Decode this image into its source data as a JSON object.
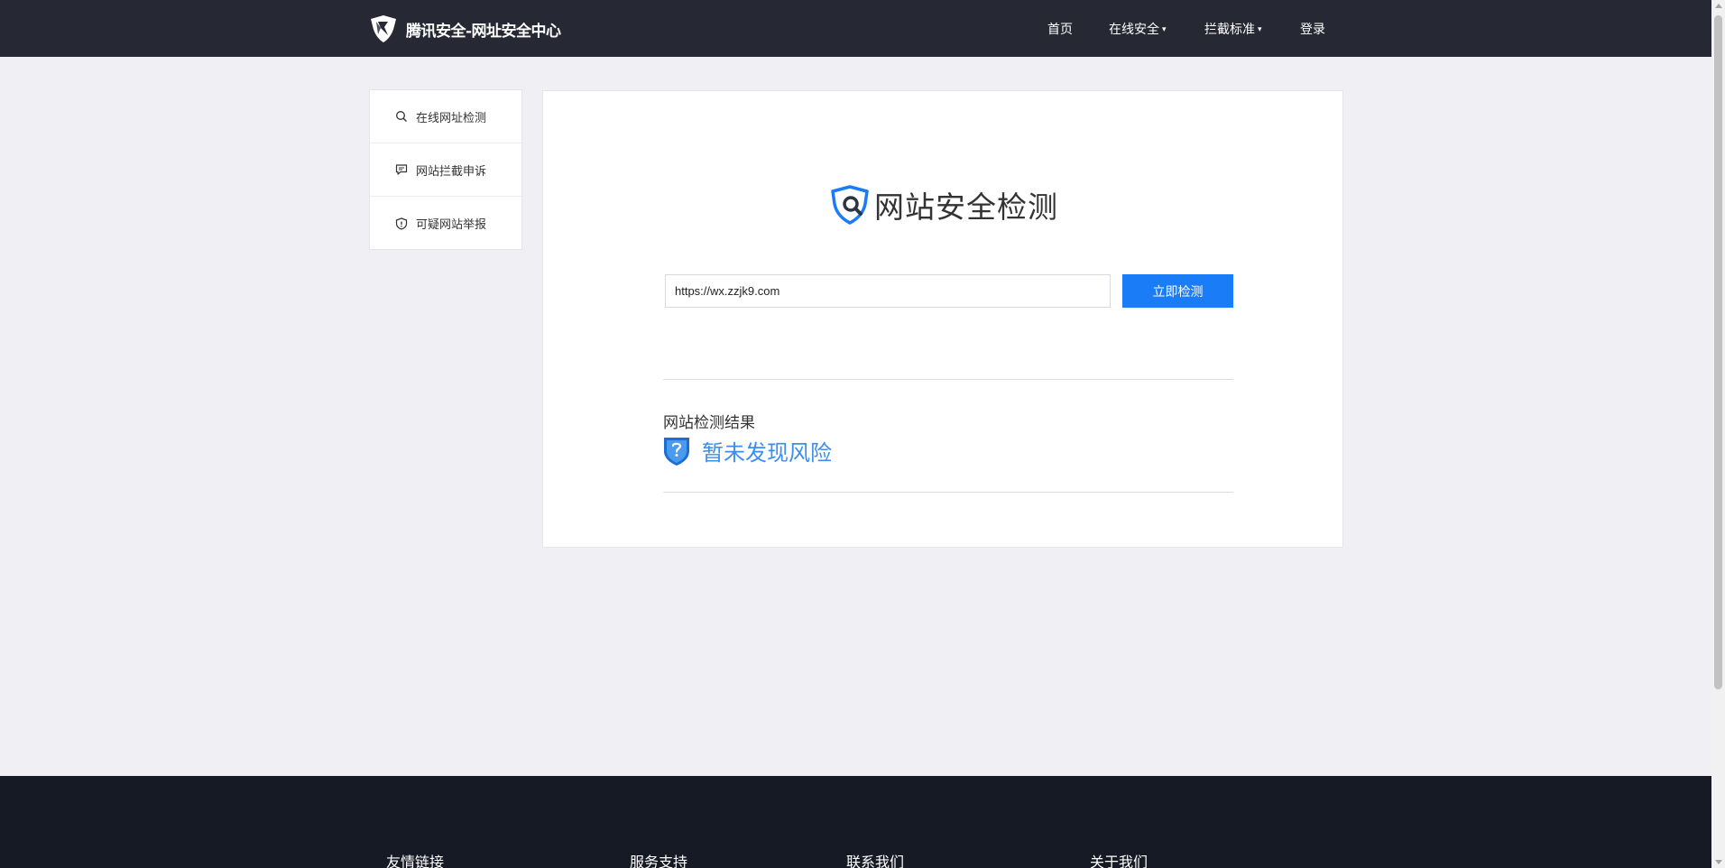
{
  "header": {
    "logo_icon": "tencent-shield-logo",
    "logo_text": "腾讯安全-网址安全中心",
    "nav": [
      {
        "label": "首页",
        "has_caret": false
      },
      {
        "label": "在线安全",
        "has_caret": true
      },
      {
        "label": "拦截标准",
        "has_caret": true
      },
      {
        "label": "登录",
        "has_caret": false
      }
    ],
    "caret": "▾"
  },
  "sidebar": {
    "items": [
      {
        "label": "在线网址检测",
        "icon": "search-icon"
      },
      {
        "label": "网站拦截申诉",
        "icon": "comment-icon"
      },
      {
        "label": "可疑网站举报",
        "icon": "shield-alert-icon"
      }
    ]
  },
  "main": {
    "title": "网站安全检测",
    "title_icon": "shield-search-icon",
    "url_value": "https://wx.zzjk9.com",
    "check_button": "立即检测",
    "result_label": "网站检测结果",
    "result_text": "暂未发现风险",
    "result_icon": "shield-question-icon"
  },
  "footer": {
    "columns": [
      "友情链接",
      "服务支持",
      "联系我们",
      "关于我们"
    ]
  },
  "colors": {
    "header_bg": "#262934",
    "page_bg": "#efeff4",
    "accent": "#1a7cf6",
    "result_text": "#3b8df0",
    "footer_bg": "#161a24"
  }
}
